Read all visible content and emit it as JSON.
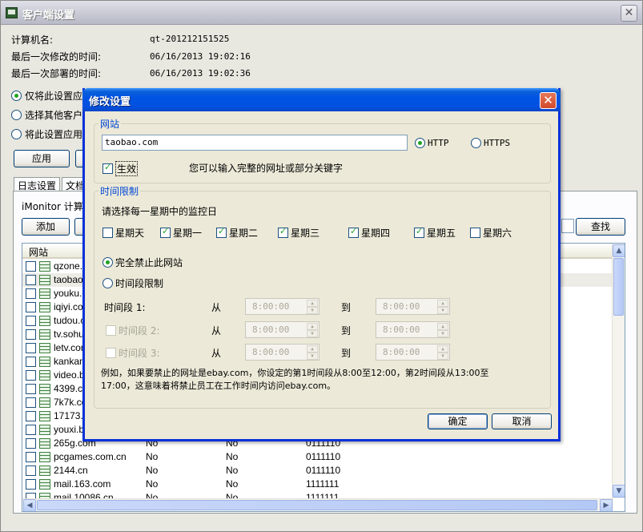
{
  "main": {
    "title": "客户端设置",
    "close": "✕",
    "info": [
      {
        "label": "计算机名:",
        "value": "qt-201212151525"
      },
      {
        "label": "最后一次修改的时间:",
        "value": "06/16/2013 19:02:16"
      },
      {
        "label": "最后一次部署的时间:",
        "value": "06/16/2013 19:02:36"
      }
    ],
    "radios": [
      "仅将此设置应",
      "选择其他客户",
      "将此设置应用"
    ],
    "apply_button": "应用",
    "tabs": [
      "日志设置",
      "文档"
    ],
    "imonitor_label": "iMonitor 计算机",
    "add_button": "添加",
    "search_button": "查找",
    "list": {
      "header": "网站",
      "rows": [
        {
          "site": "qzone.q",
          "c2": "",
          "c3": "",
          "c4": ""
        },
        {
          "site": "taobao.c",
          "c2": "",
          "c3": "",
          "c4": ""
        },
        {
          "site": "youku.c",
          "c2": "",
          "c3": "",
          "c4": ""
        },
        {
          "site": "iqiyi.com",
          "c2": "",
          "c3": "",
          "c4": ""
        },
        {
          "site": "tudou.c",
          "c2": "",
          "c3": "",
          "c4": ""
        },
        {
          "site": "tv.sohu.",
          "c2": "",
          "c3": "",
          "c4": ""
        },
        {
          "site": "letv.com",
          "c2": "",
          "c3": "",
          "c4": ""
        },
        {
          "site": "kankan.",
          "c2": "",
          "c3": "",
          "c4": ""
        },
        {
          "site": "video.ba",
          "c2": "",
          "c3": "",
          "c4": ""
        },
        {
          "site": "4399.co",
          "c2": "",
          "c3": "",
          "c4": ""
        },
        {
          "site": "7k7k.co",
          "c2": "",
          "c3": "",
          "c4": ""
        },
        {
          "site": "17173.c",
          "c2": "",
          "c3": "",
          "c4": ""
        },
        {
          "site": "youxi.ba",
          "c2": "",
          "c3": "",
          "c4": ""
        },
        {
          "site": "265g.com",
          "c2": "No",
          "c3": "No",
          "c4": "0111110"
        },
        {
          "site": "pcgames.com.cn",
          "c2": "No",
          "c3": "No",
          "c4": "0111110"
        },
        {
          "site": "2144.cn",
          "c2": "No",
          "c3": "No",
          "c4": "0111110"
        },
        {
          "site": "mail.163.com",
          "c2": "No",
          "c3": "No",
          "c4": "1111111"
        },
        {
          "site": "mail.10086.cn",
          "c2": "No",
          "c3": "No",
          "c4": "1111111"
        }
      ]
    }
  },
  "dialog": {
    "title": "修改设置",
    "close": "✕",
    "website_group": "网站",
    "url_value": "taobao.com",
    "http_label": "HTTP",
    "https_label": "HTTPS",
    "enable_label": "生效",
    "hint": "您可以输入完整的网址或部分关键字",
    "time_group": "时间限制",
    "choose_days": "请选择每一星期中的监控日",
    "days": [
      {
        "label": "星期天",
        "checked": false
      },
      {
        "label": "星期一",
        "checked": true
      },
      {
        "label": "星期二",
        "checked": true
      },
      {
        "label": "星期三",
        "checked": true
      },
      {
        "label": "星期四",
        "checked": true
      },
      {
        "label": "星期五",
        "checked": true
      },
      {
        "label": "星期六",
        "checked": false
      }
    ],
    "block_all": "完全禁止此网站",
    "time_limit": "时间段限制",
    "periods": [
      {
        "label": "时间段 1:",
        "from": "从",
        "to": "到",
        "start": "8:00:00",
        "end": "8:00:00"
      },
      {
        "label": "时间段 2:",
        "from": "从",
        "to": "到",
        "start": "8:00:00",
        "end": "8:00:00"
      },
      {
        "label": "时间段 3:",
        "from": "从",
        "to": "到",
        "start": "8:00:00",
        "end": "8:00:00"
      }
    ],
    "note": "例如，如果要禁止的网址是ebay.com，你设定的第1时间段从8:00至12:00，第2时间段从13:00至17:00，这意味着将禁止员工在工作时间内访问ebay.com。",
    "ok_button": "确定",
    "cancel_button": "取消"
  }
}
